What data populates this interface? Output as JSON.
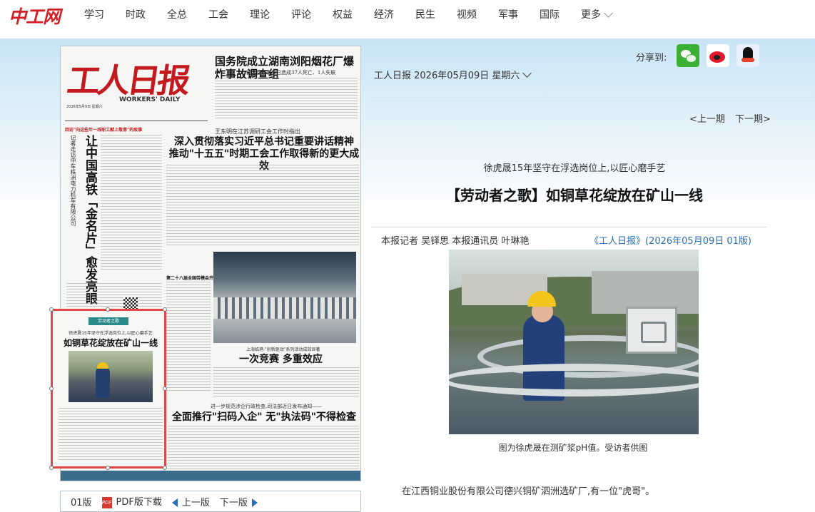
{
  "site": {
    "logo": "中工网",
    "nav": [
      "学习",
      "时政",
      "全总",
      "工会",
      "理论",
      "评论",
      "权益",
      "经济",
      "民生",
      "视频",
      "军事",
      "国际"
    ],
    "more": "更多"
  },
  "share": {
    "label": "分享到:",
    "icons": [
      "wechat-icon",
      "weibo-icon",
      "qq-icon"
    ]
  },
  "edition": {
    "date": "工人日报 2026年05月09日 星期六",
    "prev": "<上一期",
    "next": "下一期>"
  },
  "paper": {
    "masthead": "工人日报",
    "masthead_en": "WORKERS' DAILY",
    "date_line": "2026年5月9日 星期六",
    "headline_top": "国务院成立湖南浏阳烟花厂爆炸事故调查组",
    "subhead_top": "截至目前事故已造成37人死亡、1人失联",
    "red_tag": "回访\"向这些年一线职工献上敬意\"的故事",
    "vertical_head": "让中国高铁「金名片」愈发亮眼",
    "vertical_sub": "记者走访中车株洲电力机车有限公司",
    "kicker_mid": "王东明在江苏调研工会工作时指出",
    "headline_mid": "深入贯彻落实习近平总书记重要讲话精神 推动\"十五五\"时期工会工作取得新的更大成效",
    "photo_caption": "第二十八届全国劳模会开幕",
    "kicker_lower": "上海临港:\"创新驱动\"系列活动成效显著",
    "headline_lower": "一次竞赛 多重效应",
    "kicker_bottom": "进一步规范涉企行政检查,司法部近日发布通知——",
    "headline_bottom": "全面推行\"扫码入企\" 无\"执法码\"不得检查",
    "inset_tag": "劳动者之歌",
    "inset_kicker": "徐虎晟15年坚守在浮选岗位上,以匠心磨手艺",
    "inset_head": "如铜草花绽放在矿山一线"
  },
  "pager": {
    "page": "01版",
    "pdf": "PDF版下载",
    "prev": "上一版",
    "next": "下一版"
  },
  "article": {
    "subtitle": "徐虎晟15年坚守在浮选岗位上,以匠心磨手艺",
    "title": "【劳动者之歌】如铜草花绽放在矿山一线",
    "byline": "本报记者 吴铎思 本报通讯员 叶琳艳",
    "source": "《工人日报》(2026年05月09日 01版)",
    "photo_caption": "图为徐虎晟在测矿浆pH值。受访者供图",
    "first_para": "在江西铜业股份有限公司德兴铜矿泗洲选矿厂,有一位\"虎哥\"。"
  }
}
